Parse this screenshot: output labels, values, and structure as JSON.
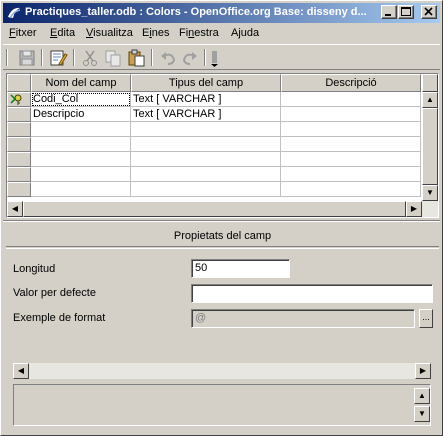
{
  "window": {
    "title": "Practiques_taller.odb : Colors - OpenOffice.org Base: disseny d...",
    "minimize": "_",
    "maximize": "□",
    "close": "×"
  },
  "menu": [
    {
      "label": "Fitxer",
      "mnemonic": "F"
    },
    {
      "label": "Edita",
      "mnemonic": "E"
    },
    {
      "label": "Visualitza",
      "mnemonic": "V"
    },
    {
      "label": "Eines",
      "mnemonic": "i"
    },
    {
      "label": "Finestra",
      "mnemonic": "n"
    },
    {
      "label": "Ajuda",
      "mnemonic": "j"
    }
  ],
  "toolbar": {
    "icons": [
      "save-icon",
      "edit-icon",
      "cut-icon",
      "copy-icon",
      "paste-icon",
      "undo-icon",
      "redo-icon",
      "primary-key-icon"
    ]
  },
  "grid": {
    "columns": [
      "Nom del camp",
      "Tipus del camp",
      "Descripció"
    ],
    "rows": [
      {
        "name": "Codi_Col",
        "type": "Text [ VARCHAR ]",
        "description": "",
        "primary_key": true
      },
      {
        "name": "Descripcio",
        "type": "Text [ VARCHAR ]",
        "description": "",
        "primary_key": false
      },
      {
        "name": "",
        "type": "",
        "description": ""
      },
      {
        "name": "",
        "type": "",
        "description": ""
      },
      {
        "name": "",
        "type": "",
        "description": ""
      },
      {
        "name": "",
        "type": "",
        "description": ""
      },
      {
        "name": "",
        "type": "",
        "description": ""
      }
    ]
  },
  "properties": {
    "title": "Propietats del camp",
    "length_label": "Longitud",
    "length_value": "50",
    "default_label": "Valor per defecte",
    "default_value": "",
    "format_label": "Exemple de format",
    "format_value": "@",
    "format_button": "..."
  },
  "scroll": {
    "up": "▲",
    "down": "▼",
    "left": "◀",
    "right": "▶"
  }
}
